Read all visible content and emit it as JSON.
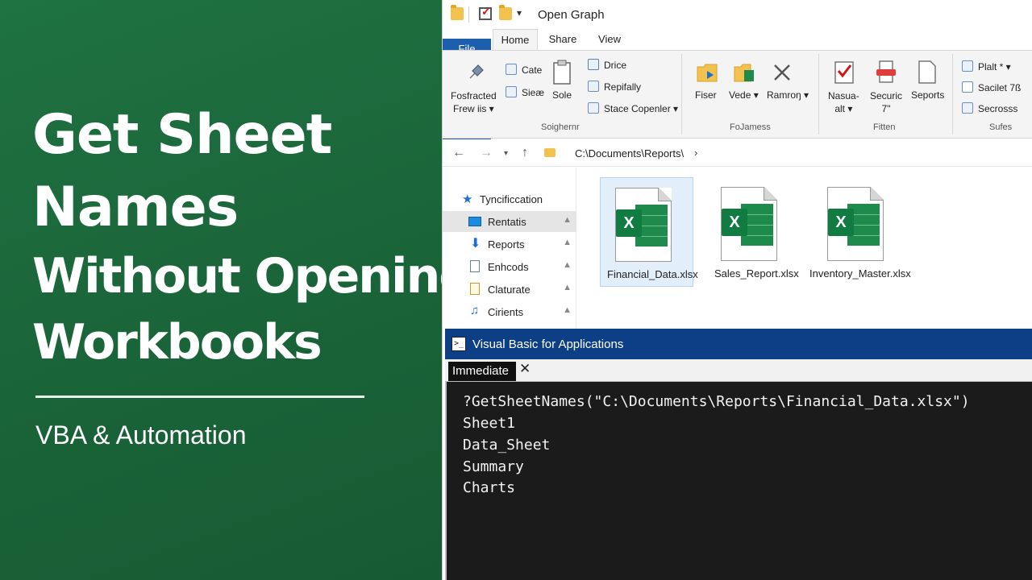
{
  "thumbnail": {
    "title_lines": [
      "Get Sheet",
      "Names",
      "Without Opening",
      "Workbooks"
    ],
    "subtitle": "VBA & Automation",
    "background_color": "#1e6b3e"
  },
  "window": {
    "title": "Open Graph",
    "tabs": [
      "File",
      "Home",
      "Share",
      "View"
    ],
    "active_tab": "Home"
  },
  "ribbon": {
    "groups": [
      {
        "label": "Soighernr",
        "items": [
          "Fosfracted\nFrew iis ▾",
          "Cate",
          "Sieæ",
          "Sole",
          "Drice",
          "Repifally",
          "Stace Copenler ▾"
        ]
      },
      {
        "label": "FoJamess",
        "items": [
          "Fiser",
          "Vede ▾",
          "Ramroŋ ▾"
        ]
      },
      {
        "label": "Fitten",
        "items": [
          "Nasua-\nalt ▾",
          "Securic\n7\"",
          "Seports"
        ]
      },
      {
        "label": "Sufes",
        "items": [
          "Plalt * ▾",
          "Sacilet 7ß",
          "Secrosss"
        ]
      }
    ]
  },
  "address": {
    "path": "C:\\Documents\\Reports\\",
    "chevron": "›"
  },
  "nav_pane": {
    "items": [
      {
        "label": "Tyncificcation",
        "icon": "star-icon",
        "pinned": false,
        "selected": false
      },
      {
        "label": "Rentatis",
        "icon": "desktop-icon",
        "pinned": true,
        "selected": true
      },
      {
        "label": "Reports",
        "icon": "download-icon",
        "pinned": true,
        "selected": false
      },
      {
        "label": "Enhcods",
        "icon": "document-icon",
        "pinned": true,
        "selected": false
      },
      {
        "label": "Claturate",
        "icon": "document-icon",
        "pinned": true,
        "selected": false
      },
      {
        "label": "Cirients",
        "icon": "music-icon",
        "pinned": true,
        "selected": false
      }
    ]
  },
  "files": [
    {
      "name": "Financial_Data.xlsx",
      "selected": true
    },
    {
      "name": "Sales_Report.xlsx",
      "selected": false
    },
    {
      "name": "Inventory_Master.xlsx",
      "selected": false
    }
  ],
  "vba": {
    "title": "Visual Basic for Applications",
    "window_tab": "Immediate",
    "close": "✕",
    "lines": [
      "?GetSheetNames(\"C:\\Documents\\Reports\\Financial_Data.xlsx\")",
      "Sheet1",
      "Data_Sheet",
      "Summary",
      "Charts"
    ]
  },
  "colors": {
    "excel_green": "#107c41",
    "title_bar_blue": "#0c3f86",
    "file_tab_blue": "#1c5fad"
  }
}
